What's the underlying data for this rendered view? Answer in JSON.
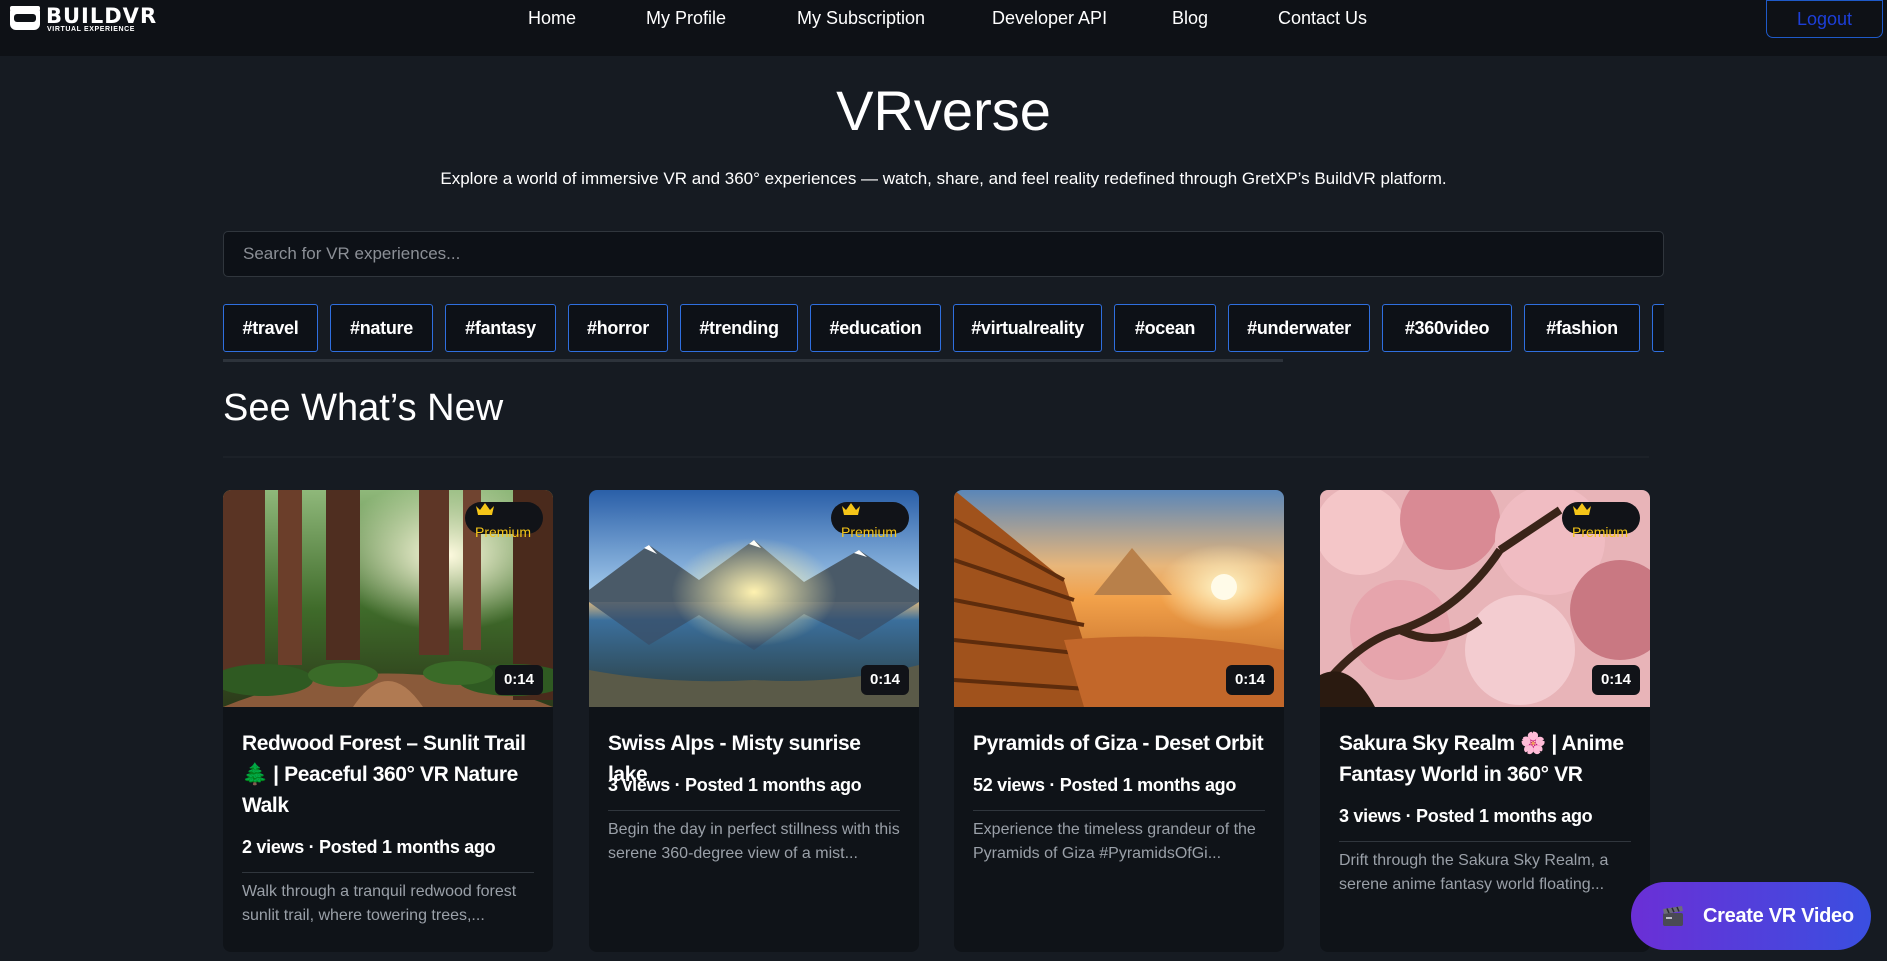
{
  "brand": {
    "name": "BUILDVR",
    "tagline": "VIRTUAL EXPERIENCE"
  },
  "nav": {
    "links": [
      "Home",
      "My Profile",
      "My Subscription",
      "Developer API",
      "Blog",
      "Contact Us"
    ],
    "logout_label": "Logout"
  },
  "hero": {
    "title": "VRverse",
    "subtitle": "Explore a world of immersive VR and 360° experiences — watch, share, and feel reality redefined through GretXP’s BuildVR platform."
  },
  "search": {
    "placeholder": "Search for VR experiences...",
    "value": ""
  },
  "tags": [
    "#travel",
    "#nature",
    "#fantasy",
    "#horror",
    "#trending",
    "#education",
    "#virtualreality",
    "#ocean",
    "#underwater",
    "#360video",
    "#fashion",
    "#"
  ],
  "section": {
    "title": "See What’s New"
  },
  "cards": [
    {
      "title": "Redwood Forest – Sunlit Trail 🌲 | Peaceful 360° VR Nature Walk",
      "meta": "2 views · Posted 1 months ago",
      "description": "Walk through a tranquil redwood forest sunlit trail, where towering trees,...",
      "premium_label": "Premium",
      "duration": "0:14",
      "premium": true
    },
    {
      "title": "Swiss Alps - Misty sunrise lake",
      "meta": "3 views · Posted 1 months ago",
      "description": "Begin the day in perfect stillness with this serene 360-degree view of a mist...",
      "premium_label": "Premium",
      "duration": "0:14",
      "premium": true
    },
    {
      "title": "Pyramids of Giza - Deset Orbit",
      "meta": "52 views · Posted 1 months ago",
      "description": "Experience the timeless grandeur of the Pyramids of Giza #PyramidsOfGi...",
      "premium_label": "",
      "duration": "0:14",
      "premium": false
    },
    {
      "title": "Sakura Sky Realm 🌸 | Anime Fantasy World in 360° VR",
      "meta": "3 views · Posted 1 months ago",
      "description": "Drift through the Sakura Sky Realm, a serene anime fantasy world floating...",
      "premium_label": "Premium",
      "duration": "0:14",
      "premium": true
    }
  ],
  "fab": {
    "label": "Create VR Video",
    "icon": "clapperboard-icon"
  },
  "colors": {
    "background": "#161b22",
    "nav": "#0e1116",
    "accent": "#2f6fdf",
    "premium": "#f5c518"
  }
}
